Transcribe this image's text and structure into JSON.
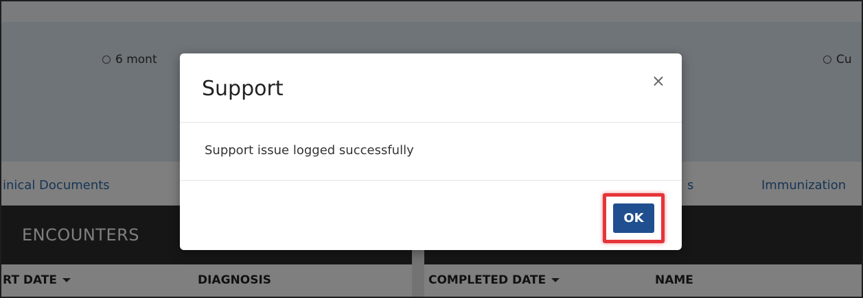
{
  "background": {
    "filter_options": [
      {
        "label": "6 mont"
      },
      {
        "label": "Cu"
      }
    ],
    "tabs": [
      {
        "label": "inical Documents"
      },
      {
        "label": "s"
      },
      {
        "label": "Immunization"
      }
    ],
    "left_panel": {
      "title": "ENCOUNTERS",
      "columns": [
        {
          "label": "RT DATE"
        },
        {
          "label": "DIAGNOSIS"
        }
      ]
    },
    "right_panel": {
      "columns": [
        {
          "label": "COMPLETED DATE"
        },
        {
          "label": "NAME"
        }
      ]
    }
  },
  "dialog": {
    "title": "Support",
    "close_symbol": "×",
    "message": "Support issue logged successfully",
    "ok_label": "OK"
  },
  "colors": {
    "overlay": "rgba(0,0,0,0.5)",
    "ok_button": "#1f4f8f",
    "highlight": "#e5353a",
    "panel_header": "#2c2c2c",
    "tab_link": "#2c6aa8"
  },
  "icons": {
    "radio": "radio-unchecked-icon",
    "sort": "caret-down-icon",
    "close": "close-icon"
  }
}
